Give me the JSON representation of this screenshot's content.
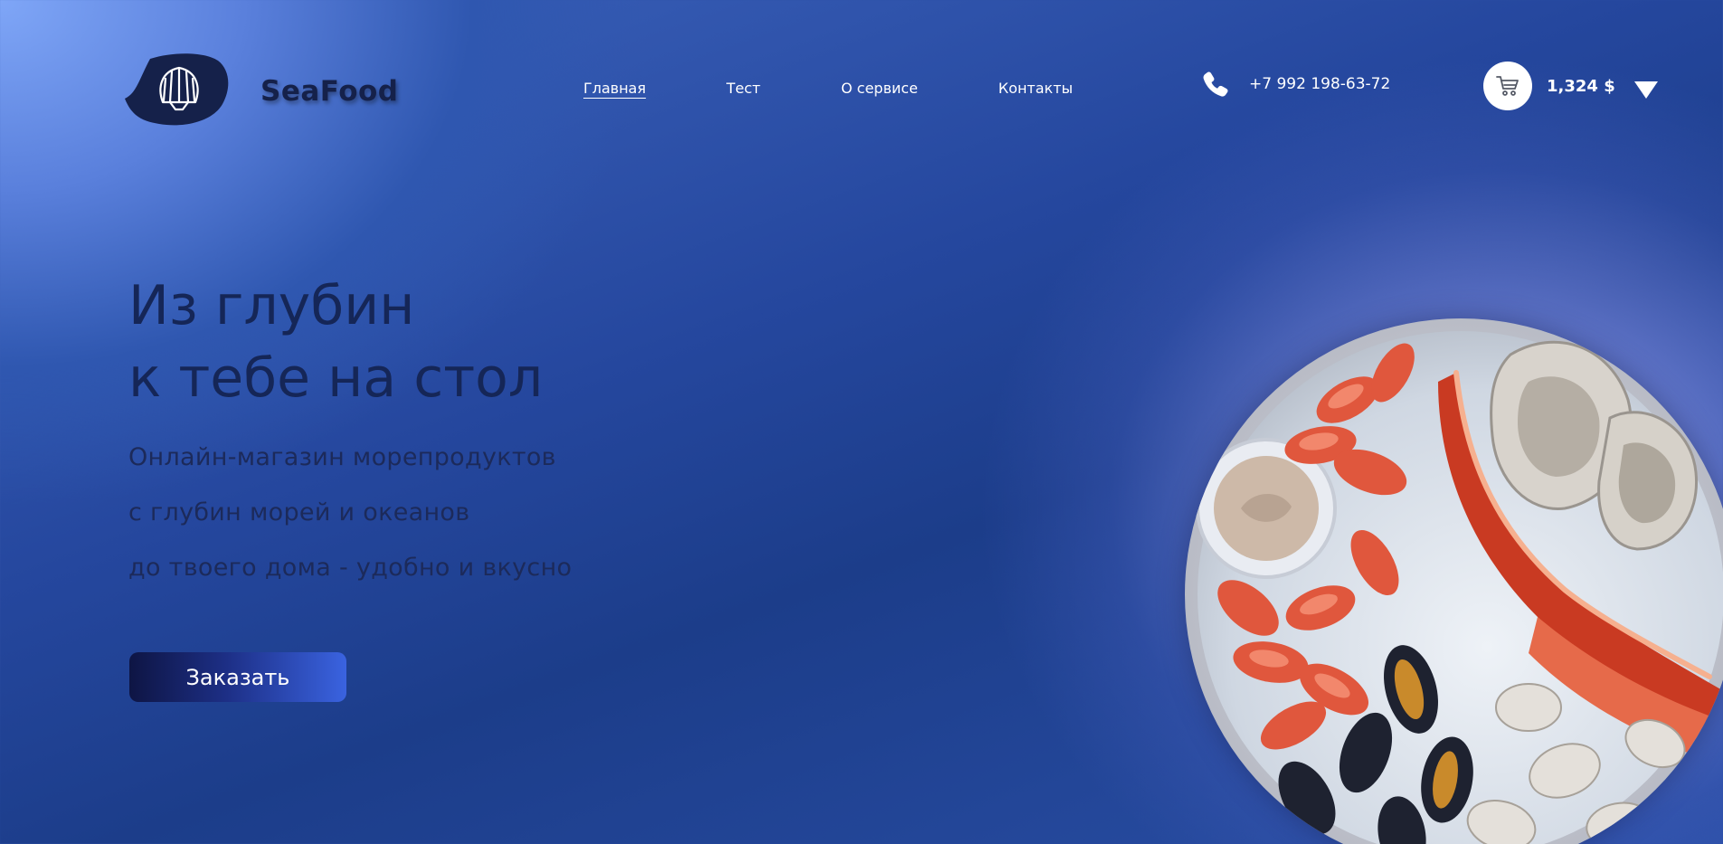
{
  "brand": {
    "name": "SeaFood",
    "logo_icon": "seashell-icon"
  },
  "nav": {
    "items": [
      {
        "label": "Главная",
        "active": true
      },
      {
        "label": "Тест",
        "active": false
      },
      {
        "label": "О сервисе",
        "active": false
      },
      {
        "label": "Контакты",
        "active": false
      }
    ]
  },
  "contact": {
    "phone": "+7 992 198-63-72",
    "icon": "phone-icon"
  },
  "cart": {
    "icon": "cart-icon",
    "total": "1,324 $"
  },
  "hero": {
    "title_lines": [
      "Из глубин",
      "к тебе на стол"
    ],
    "description_lines": [
      "Онлайн-магазин морепродуктов",
      "с глубин морей и океанов",
      "до твоего дома - удобно и вкусно"
    ],
    "cta_label": "Заказать"
  },
  "colors": {
    "accent_dark": "#15214a",
    "button_start": "#0e1544",
    "button_end": "#3a63e0",
    "background_main": "#25479e"
  }
}
